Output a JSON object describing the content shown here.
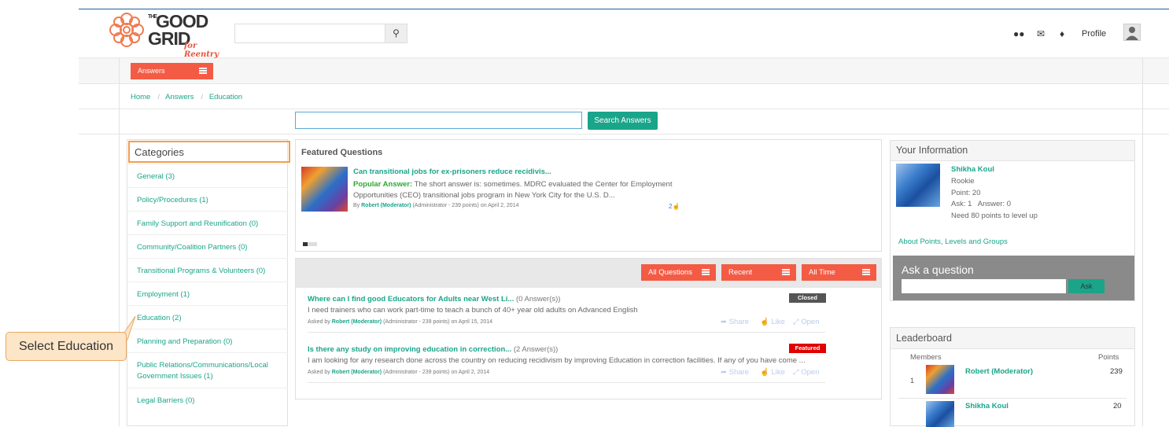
{
  "brand": {
    "name_line1": "THE",
    "name_line2": "GOOD",
    "name_line3": "GRID",
    "tagline": "for Reentry",
    "accent": "#f45b45",
    "teal": "#1aa58a"
  },
  "header": {
    "search_placeholder": "",
    "profile_label": "Profile",
    "icons": [
      "group-icon",
      "mail-icon",
      "bell-icon",
      "user-avatar-icon"
    ]
  },
  "answers_menu": {
    "label": "Answers"
  },
  "breadcrumb": [
    "Home",
    "Answers",
    "Education"
  ],
  "answer_search": {
    "value": "",
    "button": "Search Answers"
  },
  "categories": {
    "title": "Categories",
    "items": [
      "General (3)",
      "Policy/Procedures (1)",
      "Family Support and Reunification (0)",
      "Community/Coalition Partners (0)",
      "Transitional Programs & Volunteers (0)",
      "Employment (1)",
      "Education (2)",
      "Planning and Preparation (0)",
      "Public Relations/Communications/Local Government Issues (1)",
      "Legal Barriers (0)"
    ]
  },
  "callout": {
    "text": "Select Education"
  },
  "featured": {
    "title": "Featured Questions",
    "question": "Can transitional jobs for ex-prisoners reduce recidivis...",
    "popular_label": "Popular Answer:",
    "answer_line1": "The short answer is: sometimes. MDRC evaluated the Center for Employment",
    "answer_line2": "Opportunities (CEO) transitional jobs program in New York City for the U.S. D...",
    "by": "By",
    "author": "Robert (Moderator)",
    "meta": "(Administrator - 239 points)  on April 2, 2014",
    "likes": "2"
  },
  "filters": [
    "All Questions",
    "Recent",
    "All Time"
  ],
  "questions": [
    {
      "title": "Where can I find good Educators for Adults near West Li...",
      "answers": "(0 Answer(s))",
      "body": "I need trainers who can work part-time to teach a bunch of 40+ year old adults on Advanced English",
      "asked_by": "Asked by",
      "author": "Robert (Moderator)",
      "meta": "(Administrator - 239 points)  on April 15, 2014",
      "badge": "Closed",
      "badge_color": "#555555",
      "share": "Share",
      "like": "Like",
      "open": "Open"
    },
    {
      "title": "Is there any study on improving education in correction...",
      "answers": "(2 Answer(s))",
      "body": "I am looking for any research done across the country on reducing recidivism by improving Education in correction facilities. If any of you have come ...",
      "asked_by": "Asked by",
      "author": "Robert (Moderator)",
      "meta": "(Administrator - 239 points)  on April 2, 2014",
      "badge": "Featured",
      "badge_color": "#e00000",
      "share": "Share",
      "like": "Like",
      "open": "Open"
    }
  ],
  "your_info": {
    "title": "Your Information",
    "name": "Shikha Koul",
    "rank": "Rookie",
    "points": "Point: 20",
    "ask_answer": "Ask: 1   Answer: 0",
    "level_note": "Need 80 points to level up",
    "link": "About Points, Levels and Groups"
  },
  "ask": {
    "title": "Ask a question",
    "button": "Ask",
    "value": ""
  },
  "leaderboard": {
    "title": "Leaderboard",
    "col_members": "Members",
    "col_points": "Points",
    "rows": [
      {
        "rank": "1",
        "name": "Robert (Moderator)",
        "points": "239"
      },
      {
        "rank": "",
        "name": "Shikha Koul",
        "points": "20"
      }
    ]
  }
}
